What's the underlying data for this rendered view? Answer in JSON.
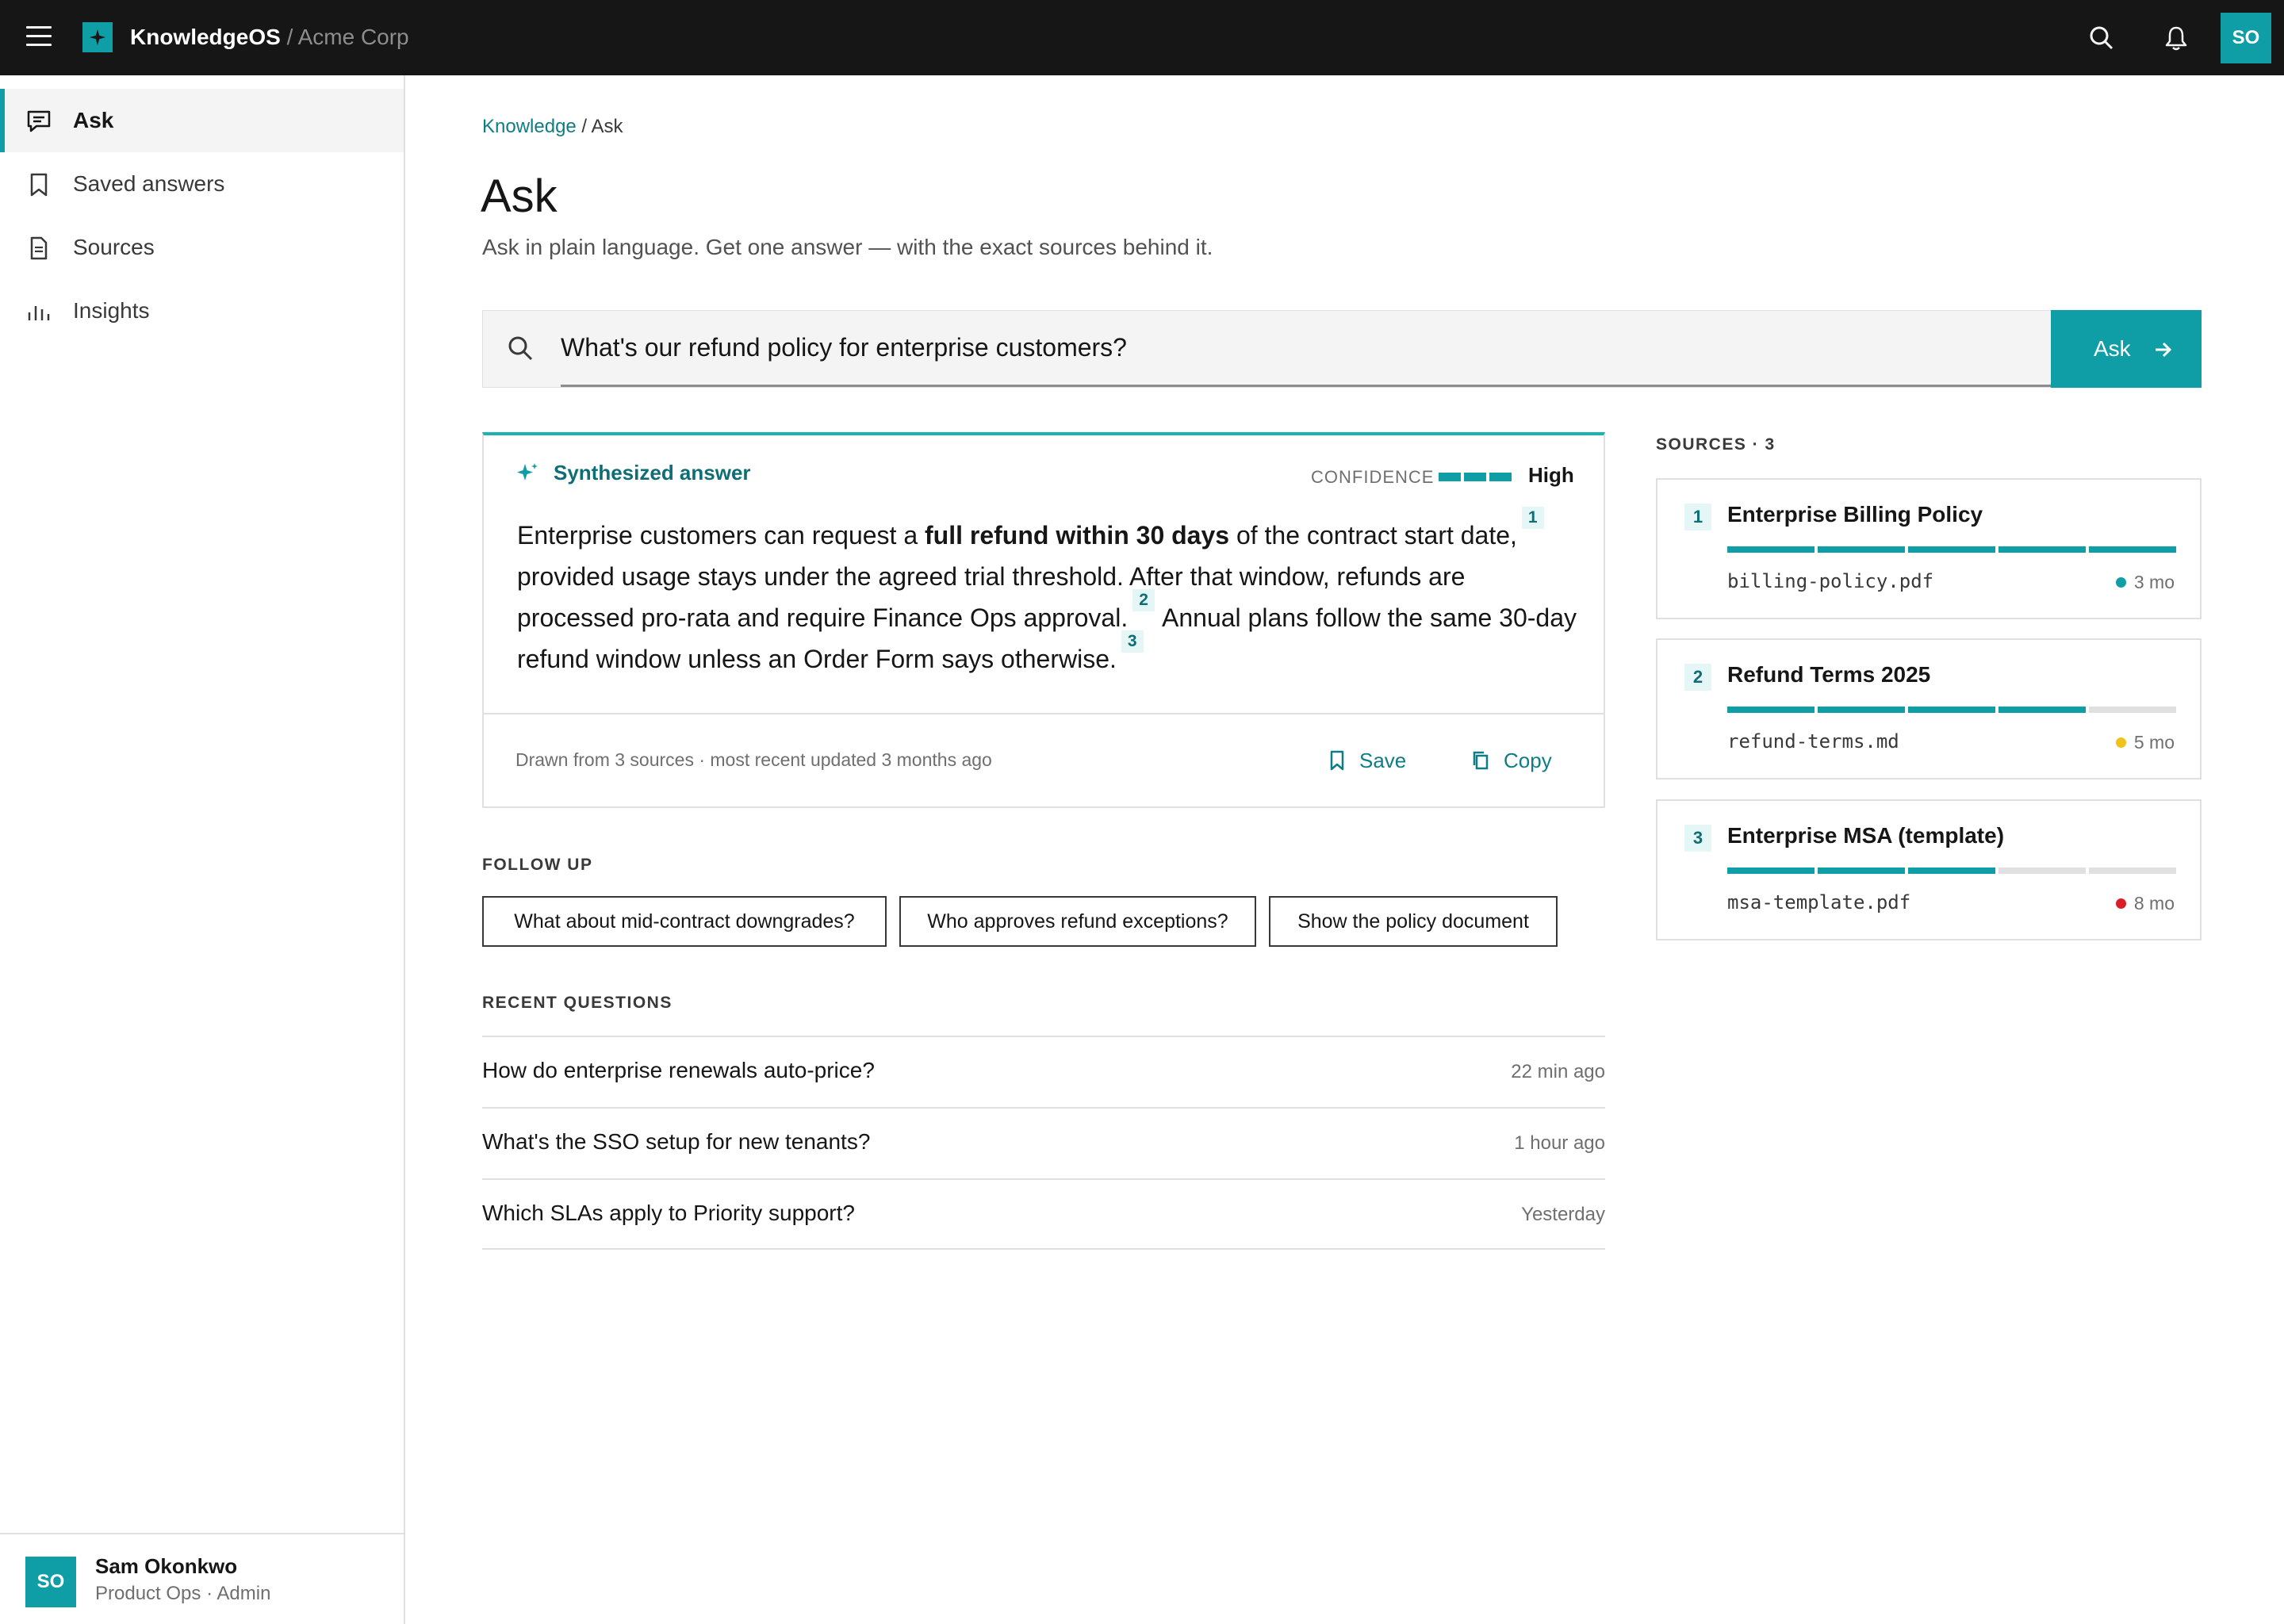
{
  "header": {
    "brand": "KnowledgeOS",
    "org": "/ Acme Corp",
    "avatar_initials": "SO",
    "icons": [
      "menu-icon",
      "search-icon",
      "bell-icon"
    ]
  },
  "sidebar": {
    "items": [
      {
        "label": "Ask",
        "icon": "chat-icon",
        "active": true
      },
      {
        "label": "Saved answers",
        "icon": "bookmark-icon"
      },
      {
        "label": "Sources",
        "icon": "document-icon"
      },
      {
        "label": "Insights",
        "icon": "bar-chart-icon"
      }
    ],
    "user": {
      "initials": "SO",
      "name": "Sam Okonkwo",
      "role": "Product Ops · Admin"
    }
  },
  "breadcrumb": {
    "parent": "Knowledge",
    "sep": " / ",
    "current": "Ask"
  },
  "page": {
    "title": "Ask",
    "subtitle": "Ask in plain language. Get one answer — with the exact sources behind it."
  },
  "search": {
    "value": "What's our refund policy for enterprise customers?",
    "button_label": "Ask"
  },
  "answer": {
    "heading": "Synthesized answer",
    "confidence_label": "CONFIDENCE",
    "confidence_level": "High",
    "confidence_fraction": 1.0,
    "text": {
      "p1": "Enterprise customers can request a ",
      "bold": "full refund within 30 days",
      "p2": " of the contract start date,",
      "c1": "1",
      "p3": " provided usage stays under the agreed trial threshold. After that window, refunds are processed pro-rata and require Finance Ops approval.",
      "c2": "2",
      "p4": " Annual plans follow the same 30-day refund window unless an Order Form says otherwise.",
      "c3": "3"
    },
    "footer_text": "Drawn from 3 sources · most recent updated 3 months ago",
    "save_label": "Save",
    "copy_label": "Copy"
  },
  "follow_up": {
    "label": "FOLLOW UP",
    "items": [
      "What about mid-contract downgrades?",
      "Who approves refund exceptions?",
      "Show the policy document"
    ]
  },
  "recent": {
    "label": "RECENT QUESTIONS",
    "items": [
      {
        "question": "How do enterprise renewals auto-price?",
        "time": "22 min ago"
      },
      {
        "question": "What's the SSO setup for new tenants?",
        "time": "1 hour ago"
      },
      {
        "question": "Which SLAs apply to Priority support?",
        "time": "Yesterday"
      }
    ]
  },
  "sources": {
    "label": "SOURCES · 3",
    "items": [
      {
        "num": "1",
        "title": "Enterprise Billing Policy",
        "file": "billing-policy.pdf",
        "age": "3 mo",
        "status_color": "#0f9ea6",
        "relevance_segments": 5,
        "segments_total": 5
      },
      {
        "num": "2",
        "title": "Refund Terms 2025",
        "file": "refund-terms.md",
        "age": "5 mo",
        "status_color": "#f1c21b",
        "relevance_segments": 4,
        "segments_total": 5
      },
      {
        "num": "3",
        "title": "Enterprise MSA (template)",
        "file": "msa-template.pdf",
        "age": "8 mo",
        "status_color": "#da1e28",
        "relevance_segments": 3,
        "segments_total": 5
      }
    ]
  },
  "colors": {
    "accent": "#0f9ea6",
    "topbar": "#161616"
  }
}
